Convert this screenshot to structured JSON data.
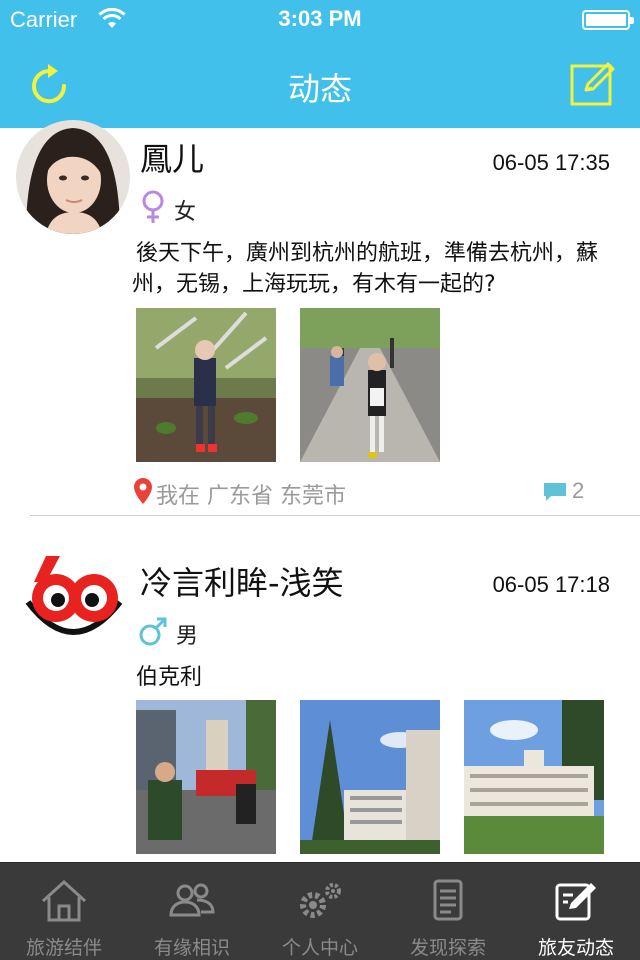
{
  "status_bar": {
    "carrier": "Carrier",
    "time": "3:03 PM"
  },
  "nav": {
    "title": "动态",
    "left_icon": "refresh-icon",
    "right_icon": "compose-icon"
  },
  "posts": [
    {
      "name": "鳳儿",
      "date": "06-05 17:35",
      "gender": "女",
      "gender_icon": "female-icon",
      "content": "後天下午，廣州到杭州的航班，準備去杭州，蘇州，无锡，上海玩玩，有木有一起的?",
      "location": "我在 广东省 东莞市",
      "comment_count": "2"
    },
    {
      "name": "冷言利眸-浅笑",
      "date": "06-05 17:18",
      "gender": "男",
      "gender_icon": "male-icon",
      "content": "伯克利",
      "avatar_text": "60"
    }
  ],
  "tabs": [
    {
      "label": "旅游结伴",
      "icon": "home-icon"
    },
    {
      "label": "有缘相识",
      "icon": "people-icon"
    },
    {
      "label": "个人中心",
      "icon": "gears-icon"
    },
    {
      "label": "发现探索",
      "icon": "document-icon"
    },
    {
      "label": "旅友动态",
      "icon": "edit-icon",
      "active": true
    }
  ],
  "colors": {
    "header": "#41c0ec",
    "accent_yellow": "#f2f23c",
    "tabbar": "#3a3a3a"
  }
}
